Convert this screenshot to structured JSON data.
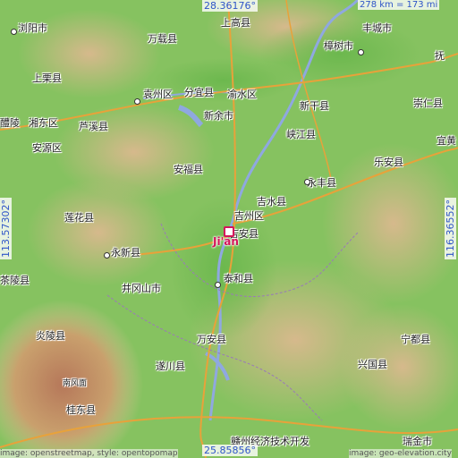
{
  "map": {
    "city": "Ji'an",
    "coords": {
      "north": "28.36176°",
      "south": "25.85856°",
      "west": "113.57302°",
      "east": "116.36552°"
    },
    "scale": "278 km = 173 mi",
    "labels": [
      "浏阳市",
      "上高县",
      "万载县",
      "丰城市",
      "樟树市",
      "上栗县",
      "袁州区",
      "分宜县",
      "渝水区",
      "抚",
      "醴陵",
      "湘东区",
      "芦溪县",
      "新余市",
      "新干县",
      "崇仁县",
      "安源区",
      "峡江县",
      "宜黄",
      "乐安县",
      "安福县",
      "吉水县",
      "永丰县",
      "吉州区",
      "吉安县",
      "莲花县",
      "永新县",
      "泰和县",
      "茶陵县",
      "井冈山市",
      "炎陵县",
      "万安县",
      "宁都县",
      "遂川县",
      "兴国县",
      "桂东县",
      "赣州经济技术开发",
      "瑞金市",
      "南风面"
    ],
    "attribution": "image: openstreetmap, style: opentopomap",
    "attribution2": "image: geo-elevation.city"
  }
}
